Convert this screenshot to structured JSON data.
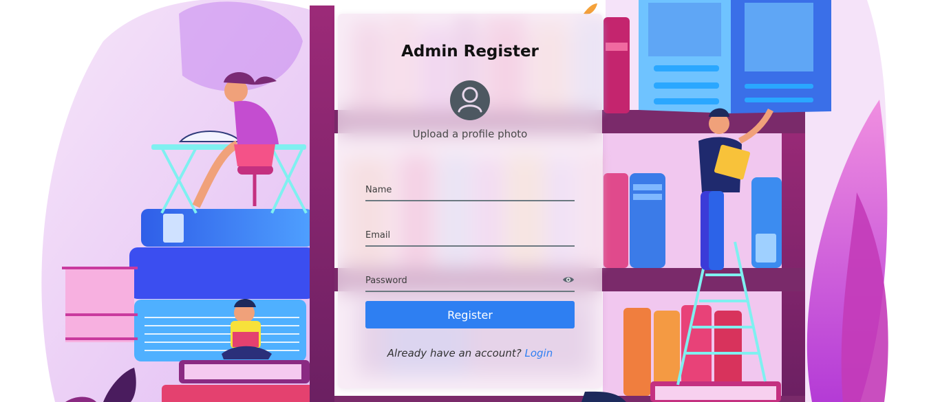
{
  "form": {
    "title": "Admin Register",
    "upload_label": "Upload a profile photo",
    "name_placeholder": "Name",
    "email_placeholder": "Email",
    "password_placeholder": "Password",
    "submit_label": "Register",
    "login_prompt": "Already have an account?",
    "login_link": "Login"
  },
  "colors": {
    "accent": "#2e7ff2",
    "avatar": "#4d5861",
    "field_underline": "#6b7880"
  },
  "icons": {
    "avatar": "user-circle-icon",
    "password_toggle": "eye-icon"
  }
}
